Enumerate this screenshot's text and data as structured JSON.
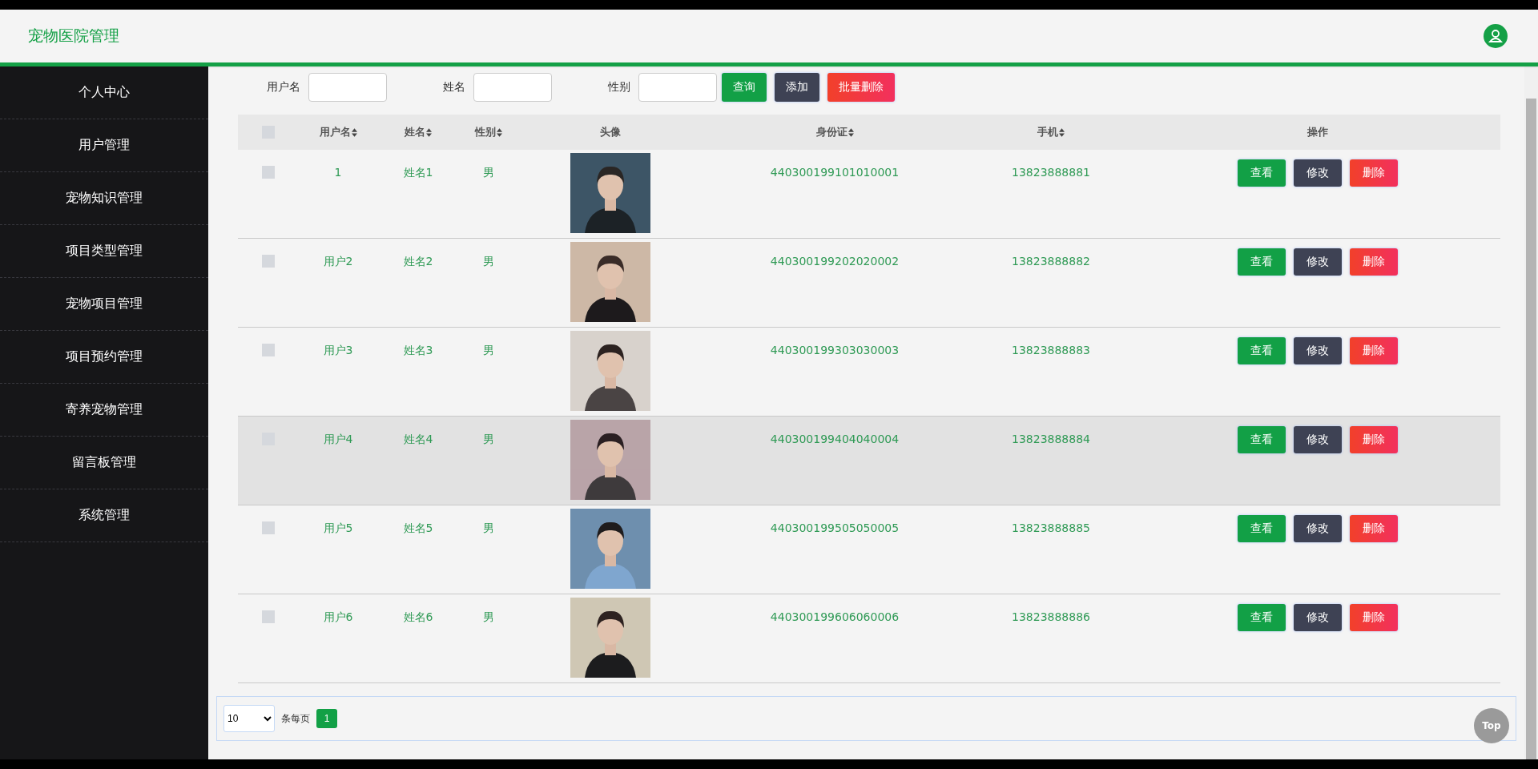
{
  "header": {
    "title": "宠物医院管理"
  },
  "sidebar": {
    "items": [
      "个人中心",
      "用户管理",
      "宠物知识管理",
      "项目类型管理",
      "宠物项目管理",
      "项目预约管理",
      "寄养宠物管理",
      "留言板管理",
      "系统管理"
    ]
  },
  "search": {
    "fields": [
      {
        "label": "用户名"
      },
      {
        "label": "姓名"
      },
      {
        "label": "性别"
      }
    ],
    "buttons": [
      {
        "label": "查询",
        "kind": "primary"
      },
      {
        "label": "添加",
        "kind": "secondary"
      },
      {
        "label": "批量删除",
        "kind": "danger"
      }
    ]
  },
  "table": {
    "select_all": {
      "checked": false
    },
    "columns": [
      {
        "label": "用户名",
        "sortable": true
      },
      {
        "label": "姓名",
        "sortable": true
      },
      {
        "label": "性别",
        "sortable": true
      },
      {
        "label": "头像",
        "sortable": false
      },
      {
        "label": "身份证",
        "sortable": true
      },
      {
        "label": "手机",
        "sortable": true
      },
      {
        "label": "操作",
        "sortable": false
      }
    ],
    "rows": [
      {
        "checked": false,
        "highlighted": false,
        "username": "1",
        "name": "姓名1",
        "gender": "男",
        "id_card": "440300199101010001",
        "phone": "13823888881",
        "actions": [
          {
            "label": "查看",
            "kind": "view"
          },
          {
            "label": "修改",
            "kind": "edit"
          },
          {
            "label": "删除",
            "kind": "delete"
          }
        ]
      },
      {
        "checked": false,
        "highlighted": false,
        "username": "用户2",
        "name": "姓名2",
        "gender": "男",
        "id_card": "440300199202020002",
        "phone": "13823888882",
        "actions": [
          {
            "label": "查看",
            "kind": "view"
          },
          {
            "label": "修改",
            "kind": "edit"
          },
          {
            "label": "删除",
            "kind": "delete"
          }
        ]
      },
      {
        "checked": false,
        "highlighted": false,
        "username": "用户3",
        "name": "姓名3",
        "gender": "男",
        "id_card": "440300199303030003",
        "phone": "13823888883",
        "actions": [
          {
            "label": "查看",
            "kind": "view"
          },
          {
            "label": "修改",
            "kind": "edit"
          },
          {
            "label": "删除",
            "kind": "delete"
          }
        ]
      },
      {
        "checked": false,
        "highlighted": true,
        "username": "用户4",
        "name": "姓名4",
        "gender": "男",
        "id_card": "440300199404040004",
        "phone": "13823888884",
        "actions": [
          {
            "label": "查看",
            "kind": "view"
          },
          {
            "label": "修改",
            "kind": "edit"
          },
          {
            "label": "删除",
            "kind": "delete"
          }
        ]
      },
      {
        "checked": false,
        "highlighted": false,
        "username": "用户5",
        "name": "姓名5",
        "gender": "男",
        "id_card": "440300199505050005",
        "phone": "13823888885",
        "actions": [
          {
            "label": "查看",
            "kind": "view"
          },
          {
            "label": "修改",
            "kind": "edit"
          },
          {
            "label": "删除",
            "kind": "delete"
          }
        ]
      },
      {
        "checked": false,
        "highlighted": false,
        "username": "用户6",
        "name": "姓名6",
        "gender": "男",
        "id_card": "440300199606060006",
        "phone": "13823888886",
        "actions": [
          {
            "label": "查看",
            "kind": "view"
          },
          {
            "label": "修改",
            "kind": "edit"
          },
          {
            "label": "删除",
            "kind": "delete"
          }
        ]
      }
    ]
  },
  "pagination": {
    "page_size": "10",
    "per_page_label": "条每页",
    "pages": [
      {
        "label": "1",
        "selected": true
      }
    ]
  },
  "back_to_top": "Top"
}
